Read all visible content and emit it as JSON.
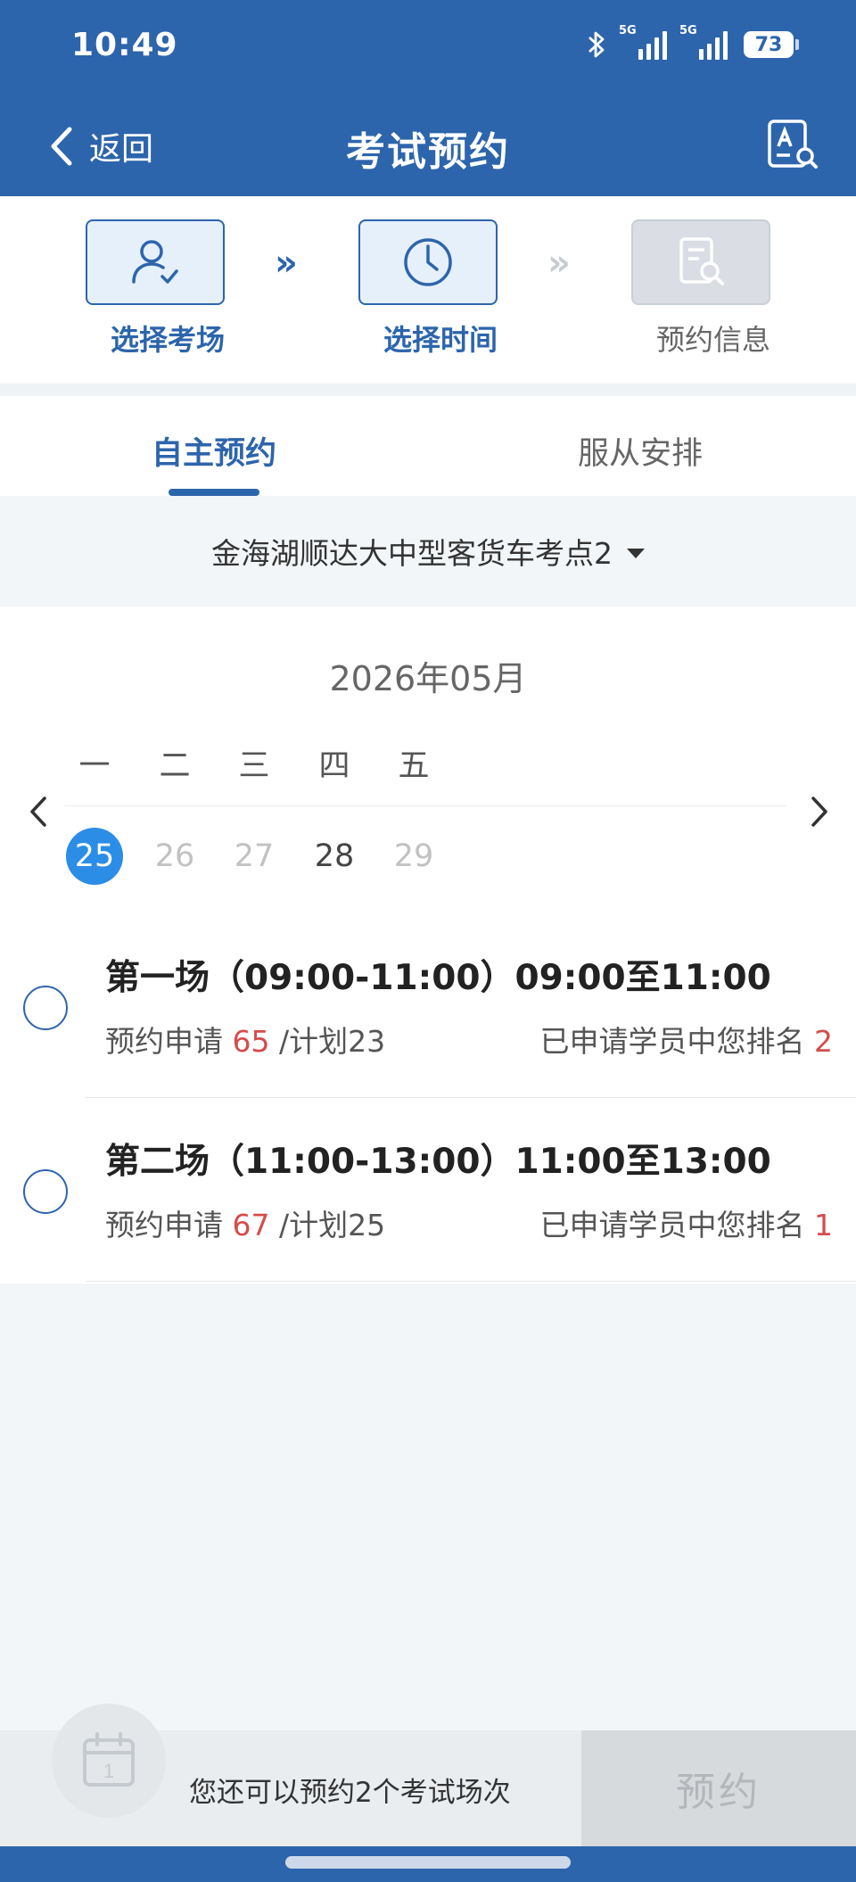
{
  "status_bar": {
    "time": "10:49",
    "signal_1_label": "5G",
    "signal_2_label": "5G",
    "battery": "73"
  },
  "nav": {
    "back_label": "返回",
    "title": "考试预约"
  },
  "steps": [
    {
      "label": "选择考场",
      "icon": "user-check-icon",
      "state": "done"
    },
    {
      "label": "选择时间",
      "icon": "clock-icon",
      "state": "active"
    },
    {
      "label": "预约信息",
      "icon": "document-search-icon",
      "state": "pending"
    }
  ],
  "step_arrow": "»",
  "tabs": {
    "active": "自主预约",
    "inactive": "服从安排"
  },
  "location": {
    "name": "金海湖顺达大中型客货车考点2"
  },
  "calendar": {
    "month": "2026年05月",
    "weekdays": [
      "一",
      "二",
      "三",
      "四",
      "五"
    ],
    "days": [
      {
        "num": "25",
        "state": "selected"
      },
      {
        "num": "26",
        "state": "disabled"
      },
      {
        "num": "27",
        "state": "disabled"
      },
      {
        "num": "28",
        "state": "available"
      },
      {
        "num": "29",
        "state": "disabled"
      }
    ]
  },
  "sessions": [
    {
      "title": "第一场（09:00-11:00）09:00至11:00",
      "apply_label": "预约申请",
      "apply_count": "65",
      "plan": "/计划23",
      "rank_label": "已申请学员中您排名",
      "rank": "2"
    },
    {
      "title": "第二场（11:00-13:00）11:00至13:00",
      "apply_label": "预约申请",
      "apply_count": "67",
      "plan": "/计划25",
      "rank_label": "已申请学员中您排名",
      "rank": "1"
    }
  ],
  "bottom": {
    "calendar_day": "1",
    "remaining_text": "您还可以预约2个考试场次",
    "book_label": "预约"
  },
  "colors": {
    "primary": "#2d65ac",
    "selected_day": "#2b8de6",
    "highlight_red": "#d54c4c"
  }
}
